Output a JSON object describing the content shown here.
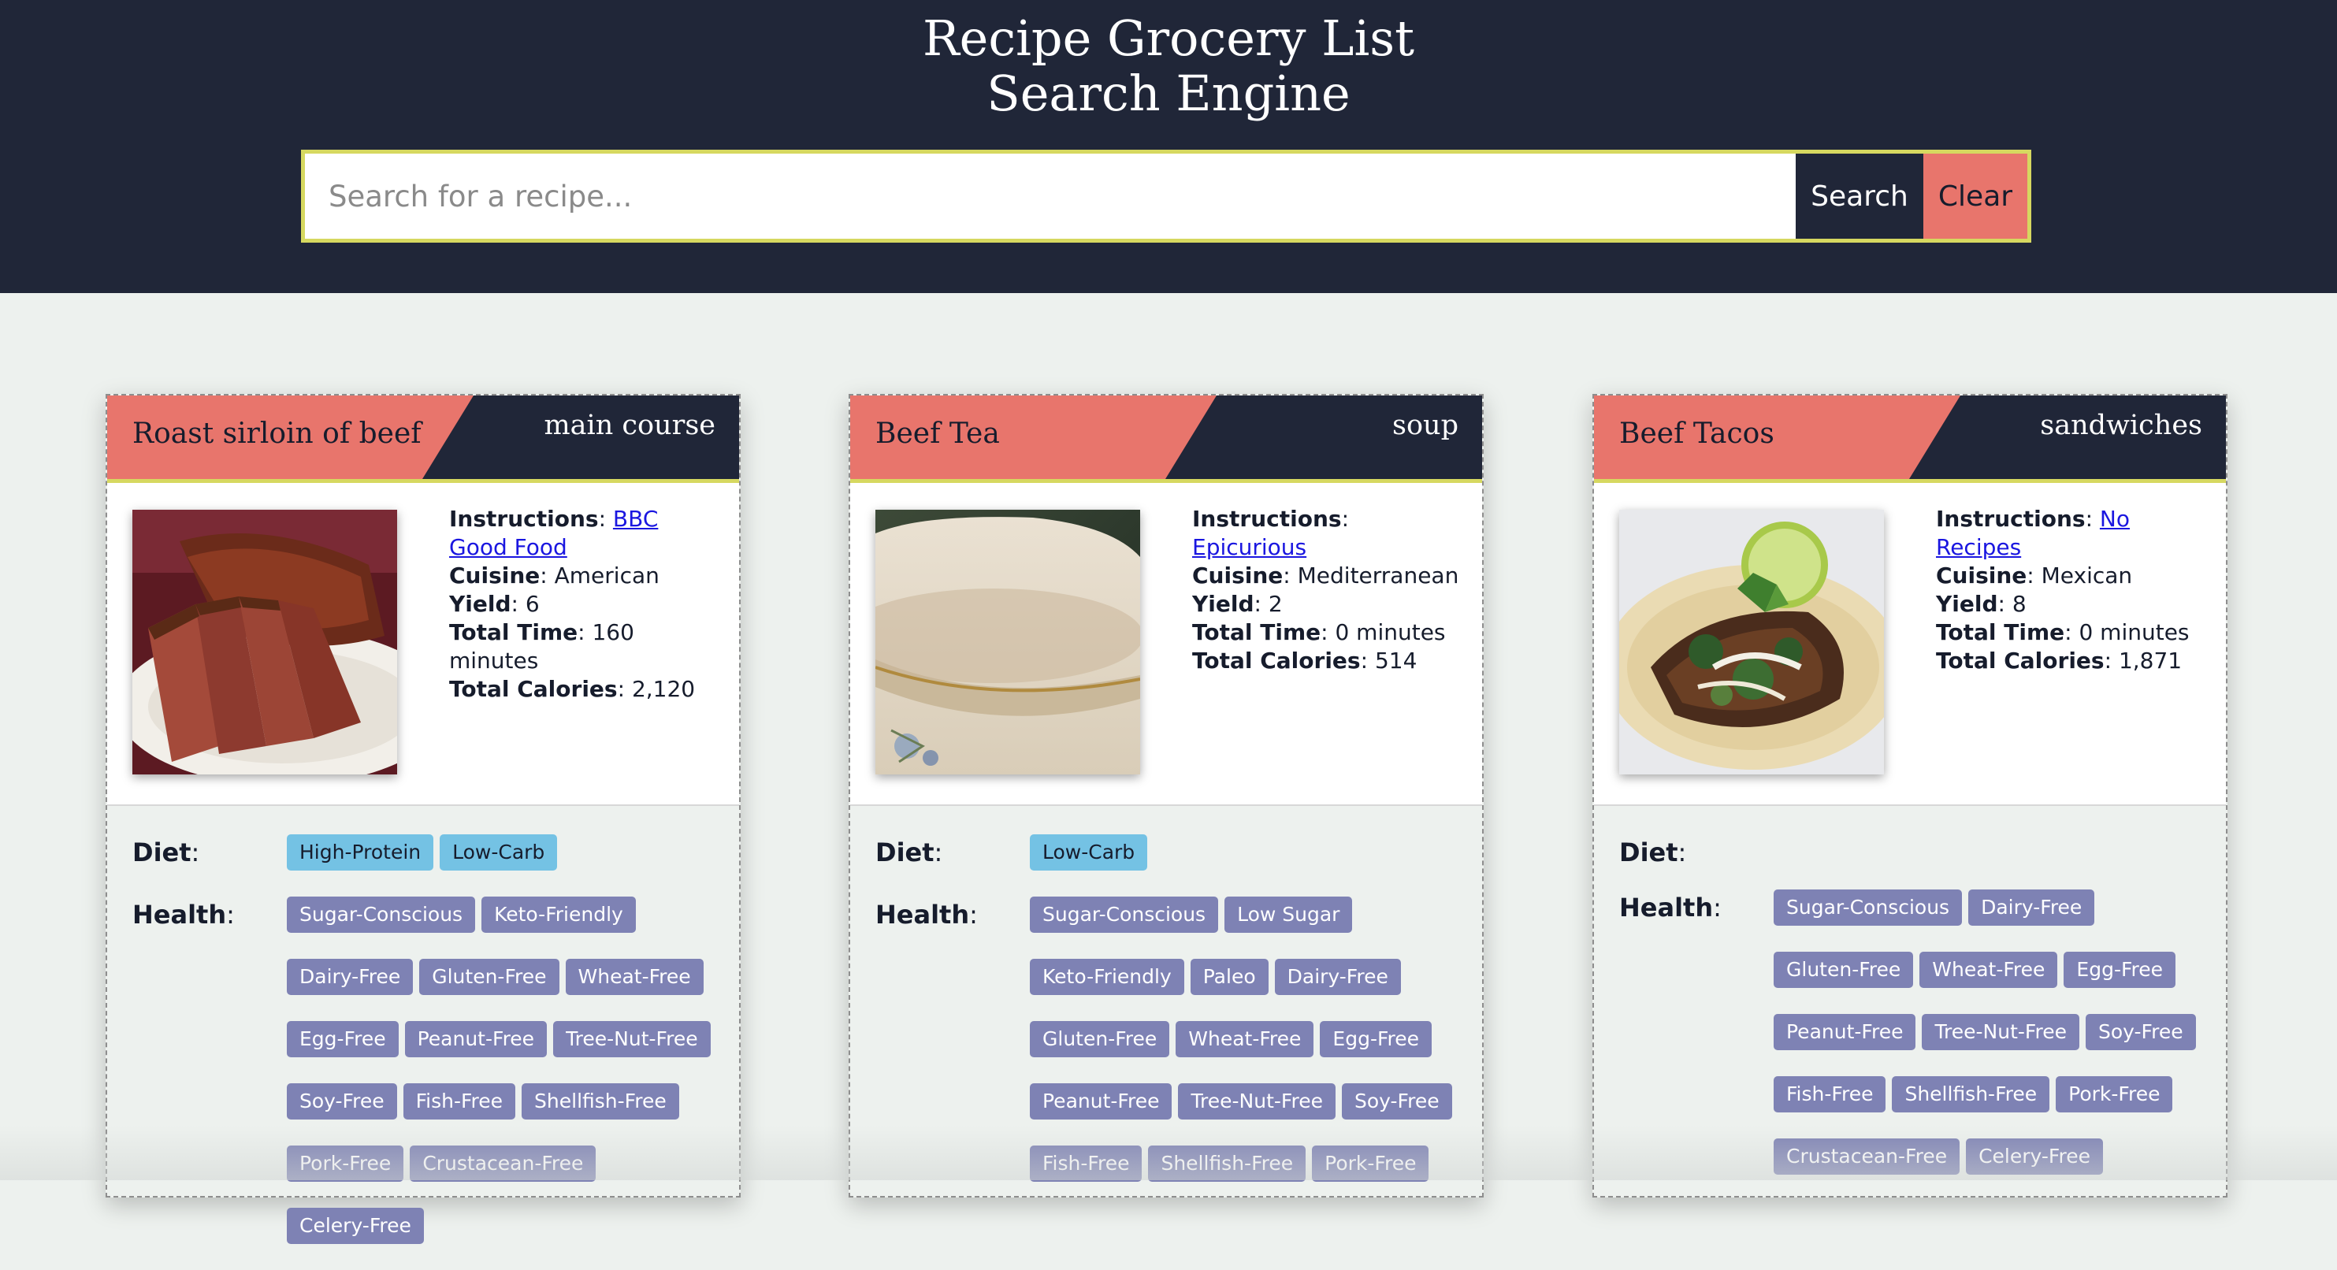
{
  "header": {
    "title_line1": "Recipe Grocery List",
    "title_line2": "Search Engine"
  },
  "search": {
    "placeholder": "Search for a recipe...",
    "search_label": "Search",
    "clear_label": "Clear"
  },
  "labels": {
    "instructions": "Instructions",
    "cuisine": "Cuisine",
    "yield": "Yield",
    "total_time": "Total Time",
    "total_calories": "Total Calories",
    "diet": "Diet",
    "health": "Health",
    "colon": ":"
  },
  "recipes": [
    {
      "name": "Roast sirloin of beef",
      "category": "main course",
      "image": "roast-beef-photo",
      "instructions_source": "BBC Good Food",
      "cuisine": "American",
      "yield": "6",
      "total_time": "160 minutes",
      "total_calories": "2,120",
      "diet": [
        "High-Protein",
        "Low-Carb"
      ],
      "health": [
        "Sugar-Conscious",
        "Keto-Friendly",
        "Dairy-Free",
        "Gluten-Free",
        "Wheat-Free",
        "Egg-Free",
        "Peanut-Free",
        "Tree-Nut-Free",
        "Soy-Free",
        "Fish-Free",
        "Shellfish-Free",
        "Pork-Free",
        "Crustacean-Free",
        "Celery-Free"
      ]
    },
    {
      "name": "Beef Tea",
      "category": "soup",
      "image": "tea-cup-photo",
      "instructions_source": "Epicurious",
      "cuisine": "Mediterranean",
      "yield": "2",
      "total_time": "0 minutes",
      "total_calories": "514",
      "diet": [
        "Low-Carb"
      ],
      "health": [
        "Sugar-Conscious",
        "Low Sugar",
        "Keto-Friendly",
        "Paleo",
        "Dairy-Free",
        "Gluten-Free",
        "Wheat-Free",
        "Egg-Free",
        "Peanut-Free",
        "Tree-Nut-Free",
        "Soy-Free",
        "Fish-Free",
        "Shellfish-Free",
        "Pork-Free"
      ]
    },
    {
      "name": "Beef Tacos",
      "category": "sandwiches",
      "image": "beef-tacos-photo",
      "instructions_source": "No Recipes",
      "cuisine": "Mexican",
      "yield": "8",
      "total_time": "0 minutes",
      "total_calories": "1,871",
      "diet": [],
      "health": [
        "Sugar-Conscious",
        "Dairy-Free",
        "Gluten-Free",
        "Wheat-Free",
        "Egg-Free",
        "Peanut-Free",
        "Tree-Nut-Free",
        "Soy-Free",
        "Fish-Free",
        "Shellfish-Free",
        "Pork-Free",
        "Crustacean-Free",
        "Celery-Free"
      ]
    }
  ],
  "colors": {
    "header_bg": "#202638",
    "accent_coral": "#e8756c",
    "search_border": "#d6d860",
    "diet_tag": "#74c2e4",
    "health_tag": "#7e82b4",
    "link": "#1a16e0"
  }
}
